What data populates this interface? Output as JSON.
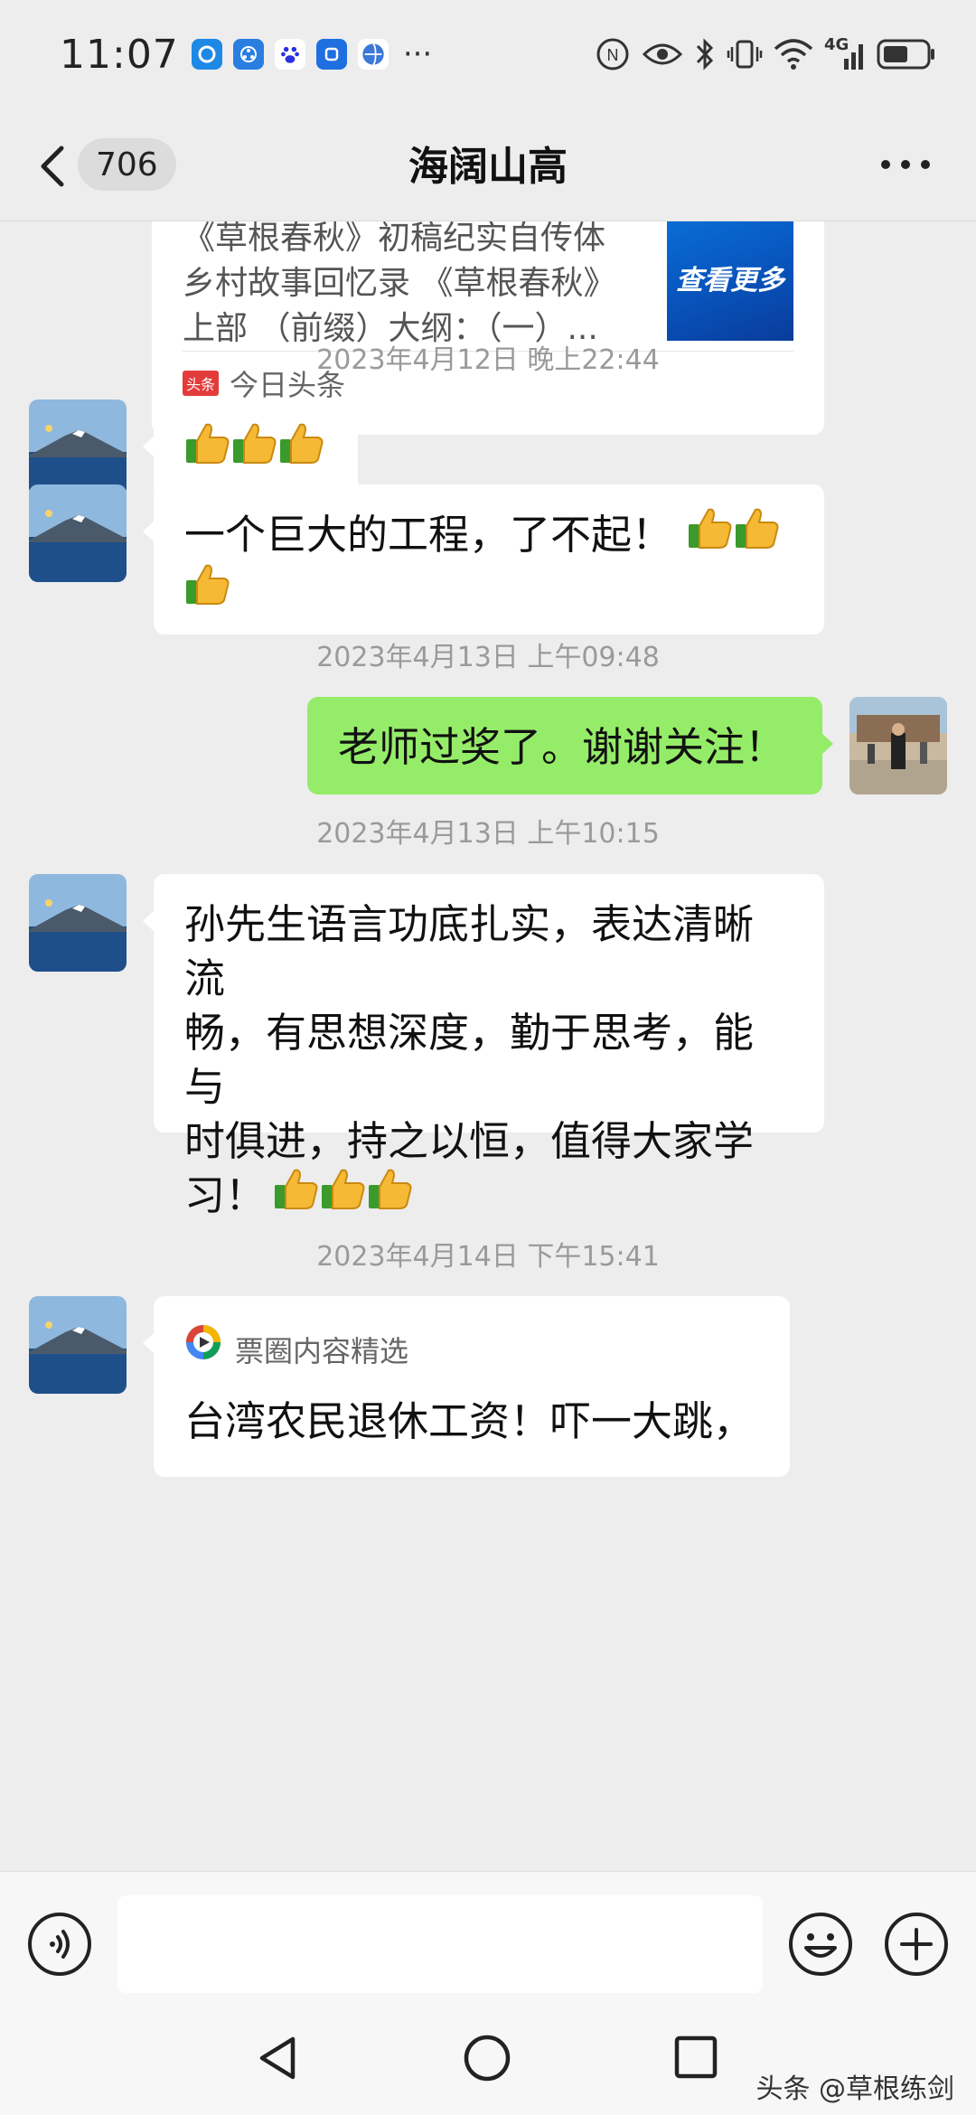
{
  "status_bar": {
    "time": "11:07",
    "more_dots": "···",
    "network_label": "4G"
  },
  "header": {
    "unread_count": "706",
    "title": "海阔山高"
  },
  "link_card": {
    "desc_line1": "《草根春秋》初稿纪实自传体",
    "desc_line2": "乡村故事回忆录 《草根春秋》",
    "desc_line3": "上部 （前缀）大纲：（一）...",
    "thumb_text": "查看更多",
    "source_badge": "头条",
    "source": "今日头条"
  },
  "messages": [
    {
      "time": "2023年4月12日 晚上22:44"
    },
    {
      "from": "other",
      "text": ""
    },
    {
      "from": "other",
      "line1": "一个巨大的工程，了不起！",
      "line2": ""
    },
    {
      "time": "2023年4月13日 上午09:48"
    },
    {
      "from": "self",
      "text": "老师过奖了。谢谢关注！"
    },
    {
      "time": "2023年4月13日 上午10:15"
    },
    {
      "from": "other",
      "line1": "孙先生语言功底扎实，表达清晰流",
      "line2": "畅，有思想深度，勤于思考，能与",
      "line3": "时俱进，持之以恒，值得大家学",
      "line4": "习！"
    },
    {
      "time": "2023年4月14日 下午15:41"
    },
    {
      "from": "other",
      "card_source": "票圈内容精选",
      "card_title": "台湾农民退休工资！吓一大跳，"
    }
  ],
  "emoji": {
    "thumbs_up": "thumbs-up-icon"
  },
  "input": {
    "value": "",
    "placeholder": ""
  },
  "nav": {
    "watermark": "头条 @草根练剑"
  },
  "colors": {
    "background": "#ededed",
    "sent_bubble": "#95ec69",
    "received_bubble": "#ffffff",
    "timestamp": "#9a9a9a"
  }
}
